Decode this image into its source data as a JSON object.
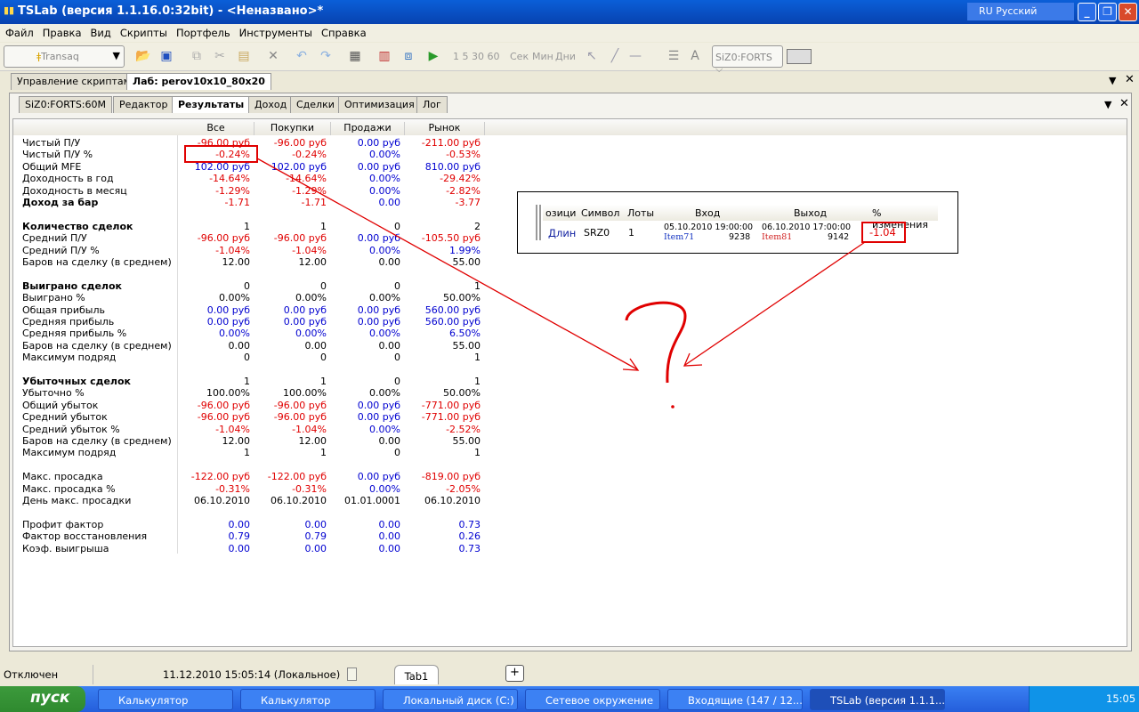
{
  "window": {
    "title": "TSLab (версия 1.1.16.0:32bit) - <Неназвано>*",
    "language": "RU Русский"
  },
  "menu": [
    "Файл",
    "Правка",
    "Вид",
    "Скрипты",
    "Портфель",
    "Инструменты",
    "Справка"
  ],
  "toolbar": {
    "connector": "Transaq",
    "intervals": "1  5  30  60",
    "units": [
      "Сек",
      "Мин",
      "Дни"
    ],
    "symbol": "SiZ0:FORTS"
  },
  "doc_tabs": [
    "Управление скриптами",
    "Лаб: perov10x10_80x20"
  ],
  "inner_tabs": [
    "SiZ0:FORTS:60M",
    "Редактор",
    "Результаты",
    "Доход",
    "Сделки",
    "Оптимизация",
    "Лог"
  ],
  "results": {
    "columns": [
      "Все",
      "Покупки",
      "Продажи",
      "Рынок"
    ],
    "rows": [
      {
        "label": "Чистый П/У",
        "values": [
          "-96.00 руб",
          "-96.00 руб",
          "0.00 руб",
          "-211.00 руб"
        ],
        "colors": [
          "r",
          "r",
          "b",
          "r"
        ]
      },
      {
        "label": "Чистый П/У %",
        "values": [
          "-0.24%",
          "-0.24%",
          "0.00%",
          "-0.53%"
        ],
        "colors": [
          "r",
          "r",
          "b",
          "r"
        ]
      },
      {
        "label": "Общий MFE",
        "values": [
          "102.00 руб",
          "102.00 руб",
          "0.00 руб",
          "810.00 руб"
        ],
        "colors": [
          "b",
          "b",
          "b",
          "b"
        ]
      },
      {
        "label": "Доходность в год",
        "values": [
          "-14.64%",
          "-14.64%",
          "0.00%",
          "-29.42%"
        ],
        "colors": [
          "r",
          "r",
          "b",
          "r"
        ]
      },
      {
        "label": "Доходность в месяц",
        "values": [
          "-1.29%",
          "-1.29%",
          "0.00%",
          "-2.82%"
        ],
        "colors": [
          "r",
          "r",
          "b",
          "r"
        ]
      },
      {
        "label": "Доход за бар",
        "bold": true,
        "values": [
          "-1.71",
          "-1.71",
          "0.00",
          "-3.77"
        ],
        "colors": [
          "r",
          "r",
          "b",
          "r"
        ]
      },
      null,
      {
        "label": "Количество сделок",
        "bold": true,
        "values": [
          "1",
          "1",
          "0",
          "2"
        ],
        "colors": [
          "k",
          "k",
          "k",
          "k"
        ]
      },
      {
        "label": "Средний П/У",
        "values": [
          "-96.00 руб",
          "-96.00 руб",
          "0.00 руб",
          "-105.50 руб"
        ],
        "colors": [
          "r",
          "r",
          "b",
          "r"
        ]
      },
      {
        "label": "Средний П/У %",
        "values": [
          "-1.04%",
          "-1.04%",
          "0.00%",
          "1.99%"
        ],
        "colors": [
          "r",
          "r",
          "b",
          "b"
        ]
      },
      {
        "label": "Баров на сделку (в среднем)",
        "values": [
          "12.00",
          "12.00",
          "0.00",
          "55.00"
        ],
        "colors": [
          "k",
          "k",
          "k",
          "k"
        ]
      },
      null,
      {
        "label": "Выиграно сделок",
        "bold": true,
        "values": [
          "0",
          "0",
          "0",
          "1"
        ],
        "colors": [
          "k",
          "k",
          "k",
          "k"
        ]
      },
      {
        "label": "Выиграно %",
        "values": [
          "0.00%",
          "0.00%",
          "0.00%",
          "50.00%"
        ],
        "colors": [
          "k",
          "k",
          "k",
          "k"
        ]
      },
      {
        "label": "Общая прибыль",
        "values": [
          "0.00 руб",
          "0.00 руб",
          "0.00 руб",
          "560.00 руб"
        ],
        "colors": [
          "b",
          "b",
          "b",
          "b"
        ]
      },
      {
        "label": "Средняя прибыль",
        "values": [
          "0.00 руб",
          "0.00 руб",
          "0.00 руб",
          "560.00 руб"
        ],
        "colors": [
          "b",
          "b",
          "b",
          "b"
        ]
      },
      {
        "label": "Средняя прибыль %",
        "values": [
          "0.00%",
          "0.00%",
          "0.00%",
          "6.50%"
        ],
        "colors": [
          "b",
          "b",
          "b",
          "b"
        ]
      },
      {
        "label": "Баров на сделку (в среднем)",
        "values": [
          "0.00",
          "0.00",
          "0.00",
          "55.00"
        ],
        "colors": [
          "k",
          "k",
          "k",
          "k"
        ]
      },
      {
        "label": "Максимум подряд",
        "values": [
          "0",
          "0",
          "0",
          "1"
        ],
        "colors": [
          "k",
          "k",
          "k",
          "k"
        ]
      },
      null,
      {
        "label": "Убыточных сделок",
        "bold": true,
        "values": [
          "1",
          "1",
          "0",
          "1"
        ],
        "colors": [
          "k",
          "k",
          "k",
          "k"
        ]
      },
      {
        "label": "Убыточно %",
        "values": [
          "100.00%",
          "100.00%",
          "0.00%",
          "50.00%"
        ],
        "colors": [
          "k",
          "k",
          "k",
          "k"
        ]
      },
      {
        "label": "Общий убыток",
        "values": [
          "-96.00 руб",
          "-96.00 руб",
          "0.00 руб",
          "-771.00 руб"
        ],
        "colors": [
          "r",
          "r",
          "b",
          "r"
        ]
      },
      {
        "label": "Средний убыток",
        "values": [
          "-96.00 руб",
          "-96.00 руб",
          "0.00 руб",
          "-771.00 руб"
        ],
        "colors": [
          "r",
          "r",
          "b",
          "r"
        ]
      },
      {
        "label": "Средний убыток %",
        "values": [
          "-1.04%",
          "-1.04%",
          "0.00%",
          "-2.52%"
        ],
        "colors": [
          "r",
          "r",
          "b",
          "r"
        ]
      },
      {
        "label": "Баров на сделку (в среднем)",
        "values": [
          "12.00",
          "12.00",
          "0.00",
          "55.00"
        ],
        "colors": [
          "k",
          "k",
          "k",
          "k"
        ]
      },
      {
        "label": "Максимум подряд",
        "values": [
          "1",
          "1",
          "0",
          "1"
        ],
        "colors": [
          "k",
          "k",
          "k",
          "k"
        ]
      },
      null,
      {
        "label": "Макс. просадка",
        "values": [
          "-122.00 руб",
          "-122.00 руб",
          "0.00 руб",
          "-819.00 руб"
        ],
        "colors": [
          "r",
          "r",
          "b",
          "r"
        ]
      },
      {
        "label": "Макс. просадка %",
        "values": [
          "-0.31%",
          "-0.31%",
          "0.00%",
          "-2.05%"
        ],
        "colors": [
          "r",
          "r",
          "b",
          "r"
        ]
      },
      {
        "label": "День макс. просадки",
        "values": [
          "06.10.2010",
          "06.10.2010",
          "01.01.0001",
          "06.10.2010"
        ],
        "colors": [
          "k",
          "k",
          "k",
          "k"
        ]
      },
      null,
      {
        "label": "Профит фактор",
        "values": [
          "0.00",
          "0.00",
          "0.00",
          "0.73"
        ],
        "colors": [
          "b",
          "b",
          "b",
          "b"
        ]
      },
      {
        "label": "Фактор восстановления",
        "values": [
          "0.79",
          "0.79",
          "0.00",
          "0.26"
        ],
        "colors": [
          "b",
          "b",
          "b",
          "b"
        ]
      },
      {
        "label": "Коэф. выигрыша",
        "values": [
          "0.00",
          "0.00",
          "0.00",
          "0.73"
        ],
        "colors": [
          "b",
          "b",
          "b",
          "b"
        ]
      }
    ]
  },
  "trade_popup": {
    "headers": [
      "озици",
      "Символ",
      "Лоты",
      "Вход",
      "Выход",
      "% изменения"
    ],
    "row": {
      "position": "Длин",
      "symbol": "SRZ0",
      "lots": "1",
      "entry_time": "05.10.2010 19:00:00",
      "entry_name": "Item71",
      "entry_price": "9238",
      "exit_time": "06.10.2010 17:00:00",
      "exit_name": "Item81",
      "exit_price": "9142",
      "change": "-1.04"
    }
  },
  "annotation": {
    "mark": "?"
  },
  "status": {
    "connection": "Отключен",
    "time": "11.12.2010 15:05:14 (Локальное)",
    "tab": "Tab1",
    "add": "+"
  },
  "taskbar": {
    "start": "пуск",
    "tasks": [
      "Калькулятор",
      "Калькулятор",
      "Локальный диск (C:)",
      "Сетевое окружение",
      "Входящие (147 / 12...",
      "TSLab (версия 1.1.1..."
    ],
    "clock": "15:05"
  }
}
